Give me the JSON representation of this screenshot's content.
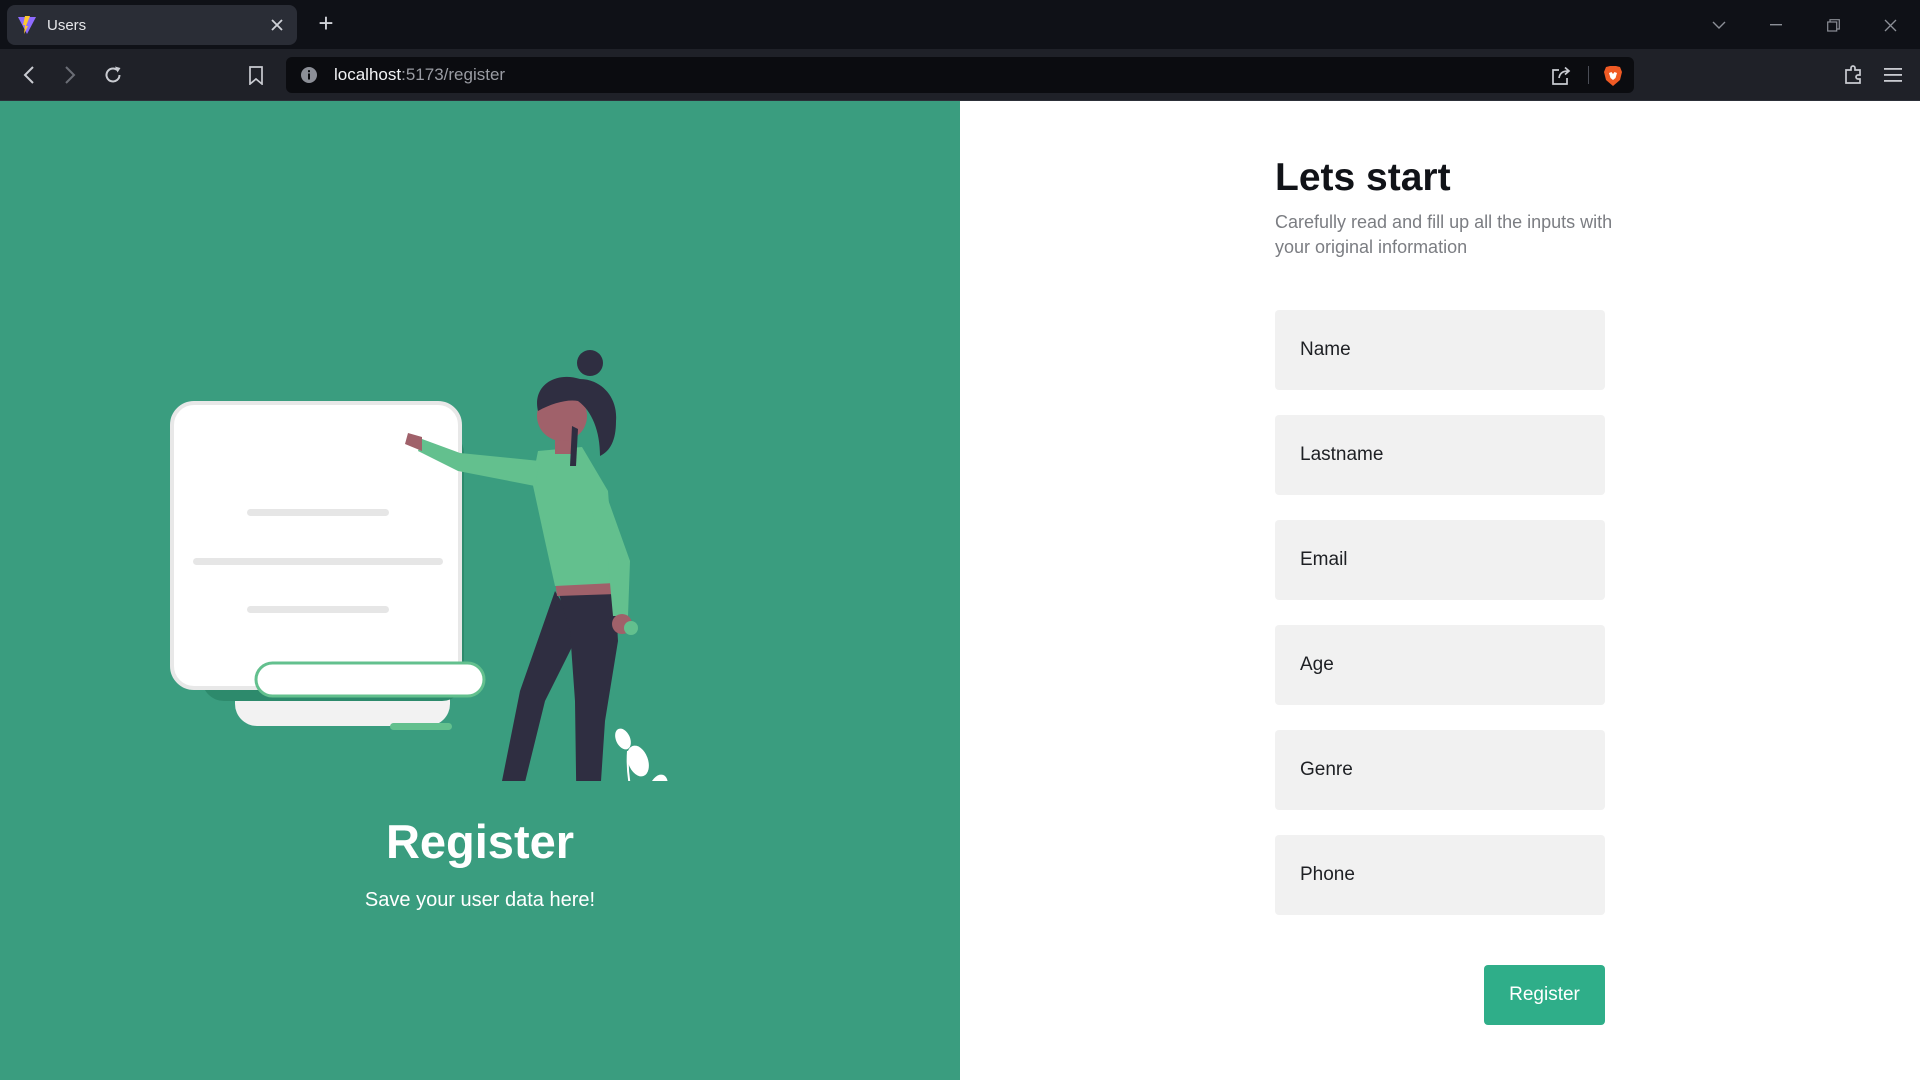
{
  "browser": {
    "tab": {
      "title": "Users",
      "close_icon": "close-icon",
      "favicon": "vite-logo"
    },
    "new_tab_label": "+",
    "url": {
      "host": "localhost",
      "rest": ":5173/register"
    }
  },
  "colors": {
    "left_panel": "#3a9d7f",
    "accent_button": "#2fae89",
    "input_background": "#f1f1f1"
  },
  "hero": {
    "title": "Register",
    "subtitle": "Save your user data here!"
  },
  "form": {
    "title": "Lets start",
    "subtitle": "Carefully read and fill up all the inputs with your original information",
    "fields": [
      {
        "placeholder": "Name",
        "value": ""
      },
      {
        "placeholder": "Lastname",
        "value": ""
      },
      {
        "placeholder": "Email",
        "value": ""
      },
      {
        "placeholder": "Age",
        "value": ""
      },
      {
        "placeholder": "Genre",
        "value": ""
      },
      {
        "placeholder": "Phone",
        "value": ""
      }
    ],
    "submit_label": "Register"
  }
}
